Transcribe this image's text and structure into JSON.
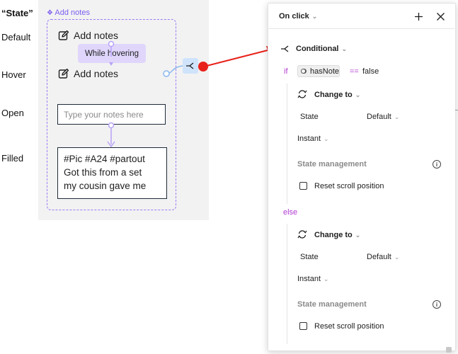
{
  "canvas": {
    "title": "“State”",
    "component_name": "Add notes",
    "row_labels": [
      "Default",
      "Hover",
      "Open",
      "Filled"
    ],
    "default_label": "Add notes",
    "hover_label": "Add notes",
    "hover_tooltip": "While hovering",
    "open_placeholder": "Type your notes here",
    "filled_text": [
      "#Pic #A24 #partout",
      "Got this from a set",
      "my cousin gave me"
    ]
  },
  "panel": {
    "trigger": "On click",
    "conditional_label": "Conditional",
    "if_keyword": "if",
    "variable": "hasNote",
    "operator": "==",
    "value": "false",
    "else_keyword": "else",
    "branches": [
      {
        "action": "Change to",
        "state_label": "State",
        "state_value": "Default",
        "animation": "Instant",
        "state_management": "State management",
        "reset_label": "Reset scroll position"
      },
      {
        "action": "Change to",
        "state_label": "State",
        "state_value": "Default",
        "animation": "Instant",
        "state_management": "State management",
        "reset_label": "Reset scroll position"
      }
    ]
  },
  "colors": {
    "accent_purple": "#9a7bf5",
    "tooltip_bg": "#e0d6fc",
    "arrow_red": "#e8221b",
    "keyword_magenta": "#b13bd1",
    "connector_blue": "#cfe3fb"
  },
  "icons": [
    "edit-icon",
    "component-icon",
    "branch-icon",
    "plus-icon",
    "close-icon",
    "swap-icon",
    "info-icon",
    "checkbox"
  ]
}
